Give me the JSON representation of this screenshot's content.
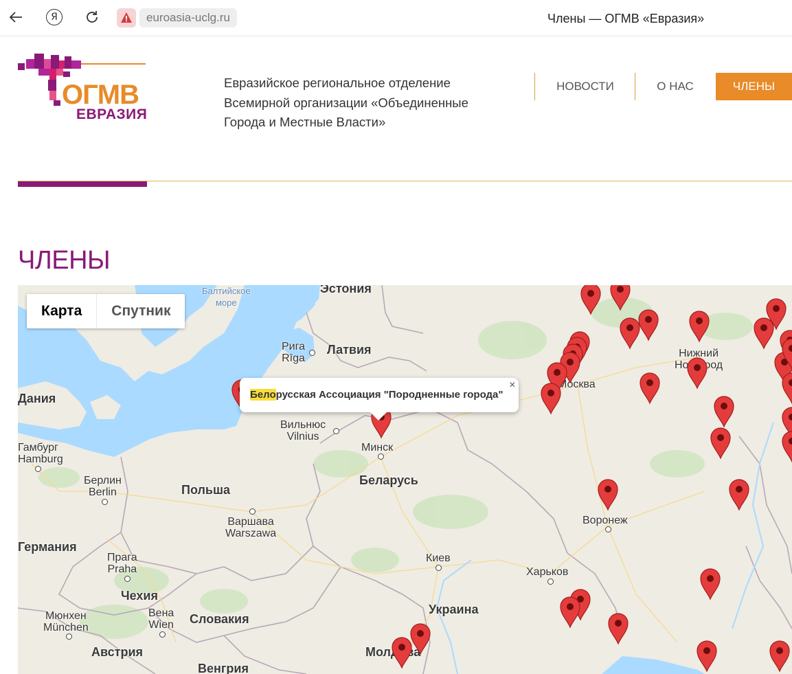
{
  "browser": {
    "host": "euroasia-uclg.ru",
    "tab_title": "Члены — ОГМВ «Евразия»"
  },
  "logo": {
    "line1": "ОГМВ",
    "line2": "ЕВРАЗИЯ"
  },
  "org_name": "Евразийское региональное отделение Всемирной организации «Объединенные Города и Местные Власти»",
  "nav": {
    "news": "НОВОСТИ",
    "about": "О НАС",
    "members": "ЧЛЕНЫ"
  },
  "page_title": "ЧЛЕНЫ",
  "map": {
    "type_map": "Карта",
    "type_satellite": "Спутник",
    "popup_highlight": "Бело",
    "popup_rest": "русская Ассоциация \"Породненные города\"",
    "popup_close": "×",
    "labels": {
      "baltic_sea": "Балтийское\nморе",
      "estonia": "Эстония",
      "riga": "Рига\nRīga",
      "latvia": "Латвия",
      "denmark": "Дания",
      "vilnius": "Вильнюс\nVilnius",
      "minsk": "Минск",
      "hamburg": "Гамбург\nHamburg",
      "berlin": "Берлин\nBerlin",
      "poland": "Польша",
      "belarus": "Беларусь",
      "warsaw": "Варшава\nWarszawa",
      "germany": "Германия",
      "prague": "Прага\nPraha",
      "czechia": "Чехия",
      "kiev": "Киев",
      "kharkov": "Харьков",
      "munich": "Мюнхен\nMünchen",
      "vienna": "Вена\nWien",
      "slovakia": "Словакия",
      "ukraine": "Украина",
      "austria": "Австрия",
      "hungary": "Венгрия",
      "moldova": "Молдова",
      "moscow": "Москва",
      "nizhny": "Нижний\nНовгород",
      "voronezh": "Воронеж"
    }
  },
  "colors": {
    "brand_purple": "#8a1a77",
    "brand_orange": "#e88b28",
    "marker_red": "#e43c3c"
  }
}
